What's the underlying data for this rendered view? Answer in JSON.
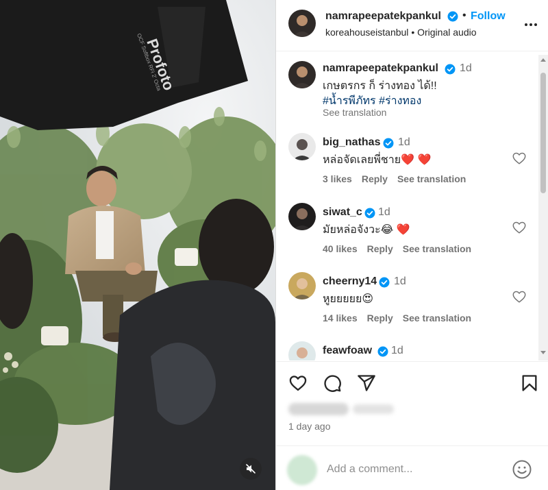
{
  "media": {
    "softbox_brand": "Profoto",
    "softbox_model": "OCF Softbox RFi 2' Octa"
  },
  "post": {
    "username": "namrapeepatekpankul",
    "dot": "•",
    "follow_label": "Follow",
    "audio_account": "koreahouseistanbul",
    "audio_label": "Original audio",
    "caption_time": "1d",
    "caption_text": "เกษตรกร ก็ ร่างทอง ได้!!",
    "caption_hashtags": "#น้ำรพีภัทร #ร่างทอง",
    "caption_see_translation": "See translation",
    "date": "1 day ago"
  },
  "comments": [
    {
      "username": "big_nathas",
      "time": "1d",
      "text": "หล่อจัดเลยพี่ชาย❤️ ❤️",
      "likes": "3 likes",
      "reply": "Reply",
      "see_translation": "See translation"
    },
    {
      "username": "siwat_c",
      "time": "1d",
      "text": "มัยหล่อจังวะ😂 ❤️",
      "likes": "40 likes",
      "reply": "Reply",
      "see_translation": "See translation"
    },
    {
      "username": "cheerny14",
      "time": "1d",
      "text": "หูยยยยย😍",
      "likes": "14 likes",
      "reply": "Reply",
      "see_translation": "See translation"
    },
    {
      "username": "feawfoaw",
      "time": "1d"
    }
  ],
  "add_comment": {
    "placeholder": "Add a comment..."
  },
  "icons": {
    "verified": "verified-badge-icon",
    "more": "more-options-icon",
    "heart": "heart-icon",
    "comment": "comment-icon",
    "share": "share-icon",
    "save": "bookmark-icon",
    "emoji": "emoji-icon",
    "mute": "speaker-muted-icon"
  },
  "colors": {
    "accent": "#0095f6",
    "text": "#262626",
    "secondary": "#737373",
    "hashtag": "#00376b",
    "heart_red": "#ed4956"
  }
}
